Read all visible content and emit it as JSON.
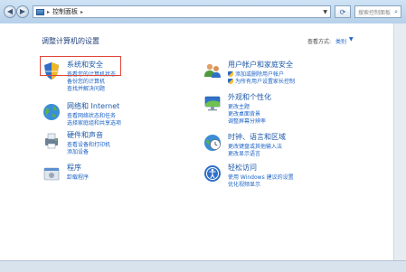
{
  "address": {
    "path_root": "控制面板",
    "search_placeholder": "搜索控制面板"
  },
  "page": {
    "title": "调整计算机的设置",
    "view_by_label": "查看方式:",
    "view_by_value": "类别"
  },
  "categories": {
    "system": {
      "title": "系统和安全",
      "links": [
        "查看您的计算机状态",
        "备份您的计算机",
        "查找并解决问题"
      ]
    },
    "network": {
      "title": "网络和 Internet",
      "links": [
        "查看网络状态和任务",
        "选择家庭组和共享选项"
      ]
    },
    "hardware": {
      "title": "硬件和声音",
      "links": [
        "查看设备和打印机",
        "添加设备"
      ]
    },
    "programs": {
      "title": "程序",
      "links": [
        "卸载程序"
      ]
    },
    "users": {
      "title": "用户帐户和家庭安全",
      "links": [
        "添加或删除用户帐户",
        "为所有用户设置家长控制"
      ]
    },
    "appearance": {
      "title": "外观和个性化",
      "links": [
        "更改主题",
        "更改桌面背景",
        "调整屏幕分辨率"
      ]
    },
    "clock": {
      "title": "时钟、语言和区域",
      "links": [
        "更改键盘或其他输入法",
        "更改显示语言"
      ]
    },
    "ease": {
      "title": "轻松访问",
      "links": [
        "使用 Windows 建议的设置",
        "优化视频显示"
      ]
    }
  },
  "colors": {
    "link": "#1c63c7",
    "heading": "#1e5aa8",
    "highlight_box": "#e0463a"
  }
}
